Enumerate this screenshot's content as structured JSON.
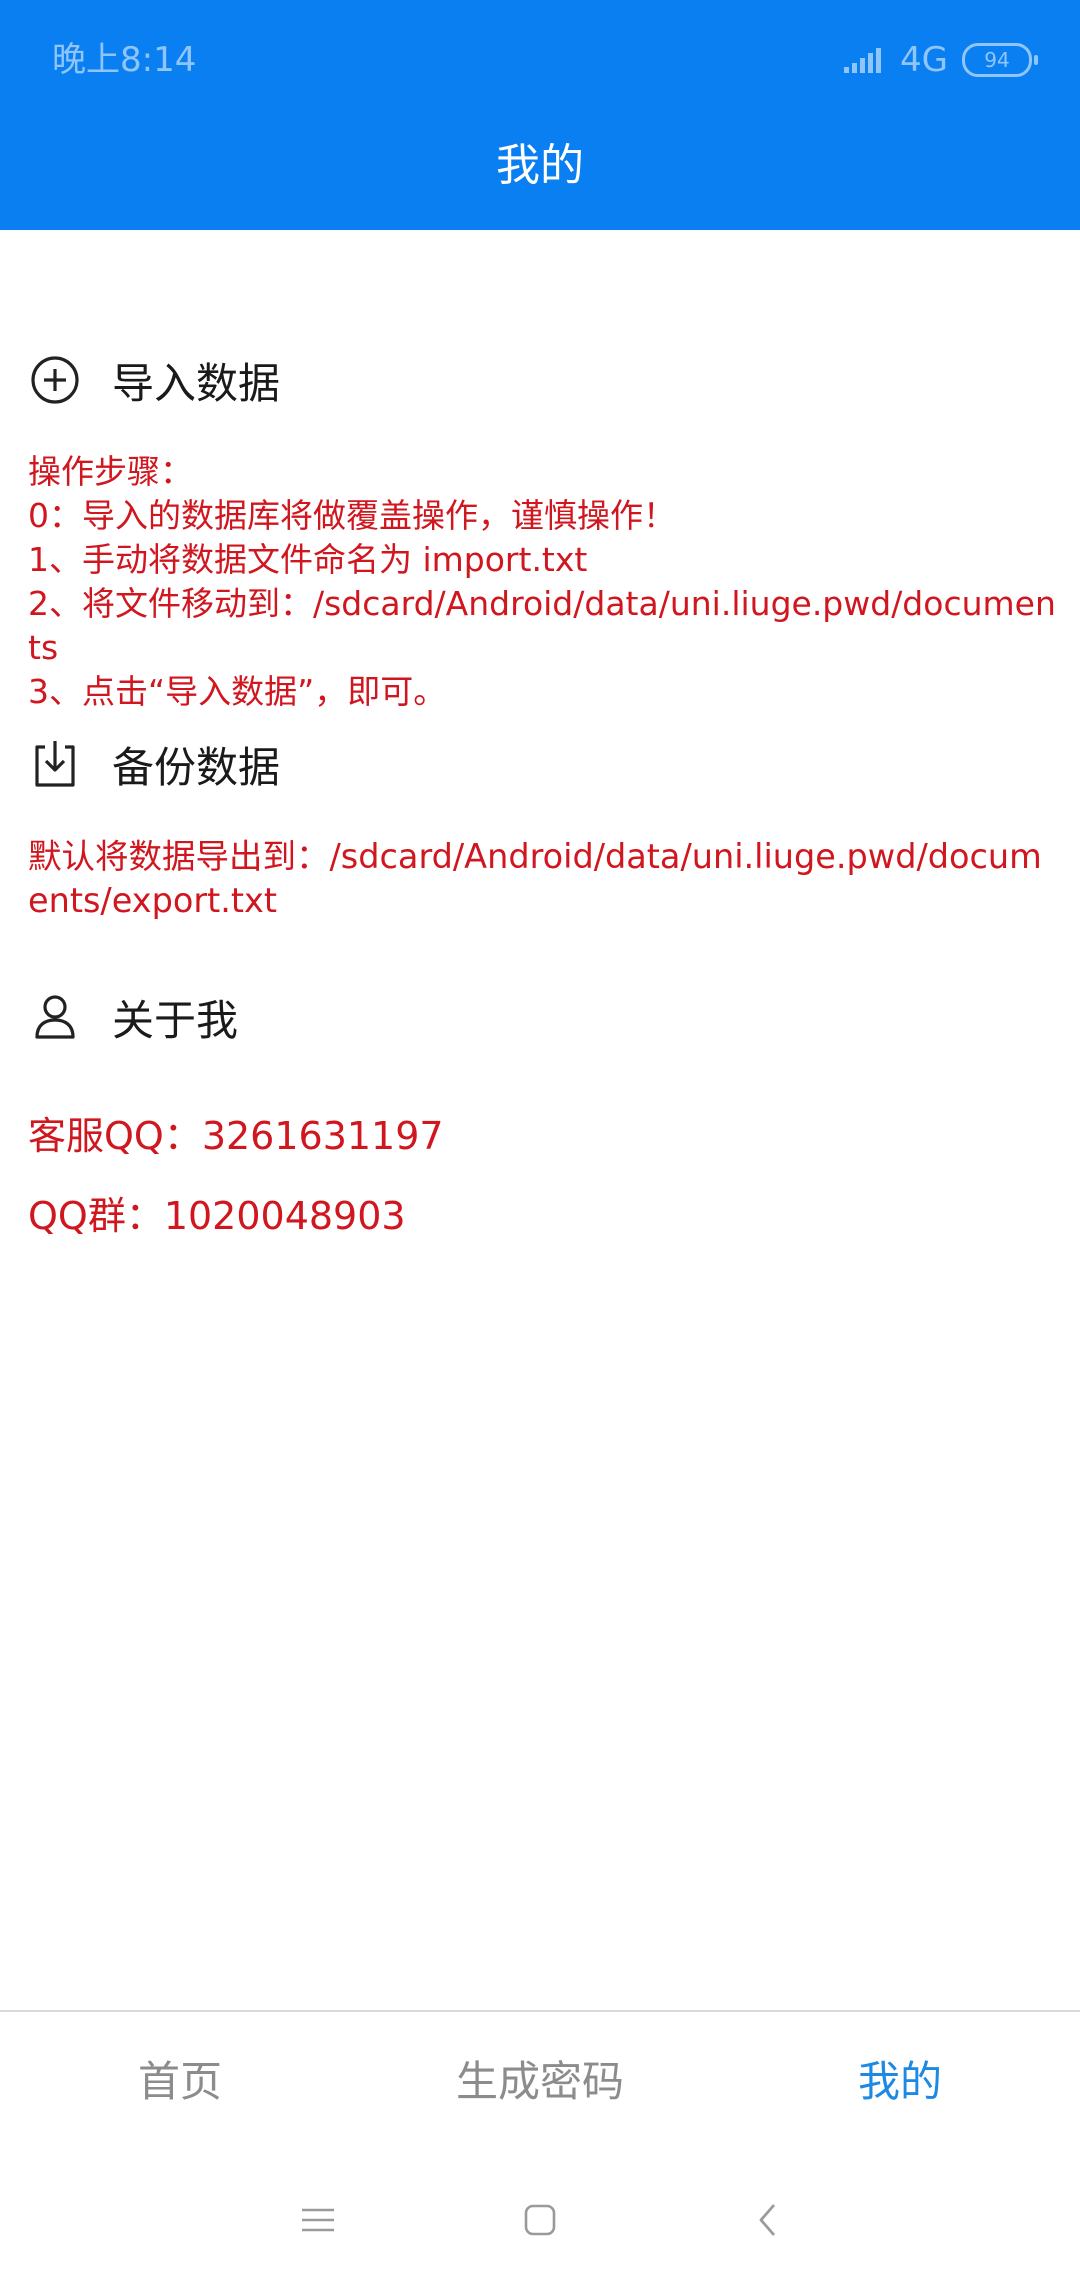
{
  "status_bar": {
    "time": "晚上8:14",
    "network": "4G",
    "battery": "94",
    "icons": [
      "signal-icon",
      "battery-icon"
    ]
  },
  "header": {
    "title": "我的",
    "color": "#0a7ff2"
  },
  "import_section": {
    "icon": "plus-circle-icon",
    "label": "导入数据",
    "steps": [
      "操作步骤：",
      "0：导入的数据库将做覆盖操作，谨慎操作！",
      "1、手动将数据文件命名为 import.txt",
      "2、将文件移动到：/sdcard/Android/data/uni.liuge.pwd/documents",
      "3、点击“导入数据”，即可。"
    ]
  },
  "backup_section": {
    "icon": "download-icon",
    "label": "备份数据",
    "note": "默认将数据导出到：/sdcard/Android/data/uni.liuge.pwd/documents/export.txt"
  },
  "about_section": {
    "icon": "user-icon",
    "label": "关于我",
    "service_qq": "客服QQ：3261631197",
    "qq_group": "QQ群：1020048903"
  },
  "tabs": [
    {
      "label": "首页",
      "active": false
    },
    {
      "label": "生成密码",
      "active": false
    },
    {
      "label": "我的",
      "active": true
    }
  ],
  "colors": {
    "accent": "#1e88e5",
    "warning_text": "#d0161e"
  },
  "nav_icons": [
    "menu-icon",
    "home-icon",
    "back-icon"
  ]
}
